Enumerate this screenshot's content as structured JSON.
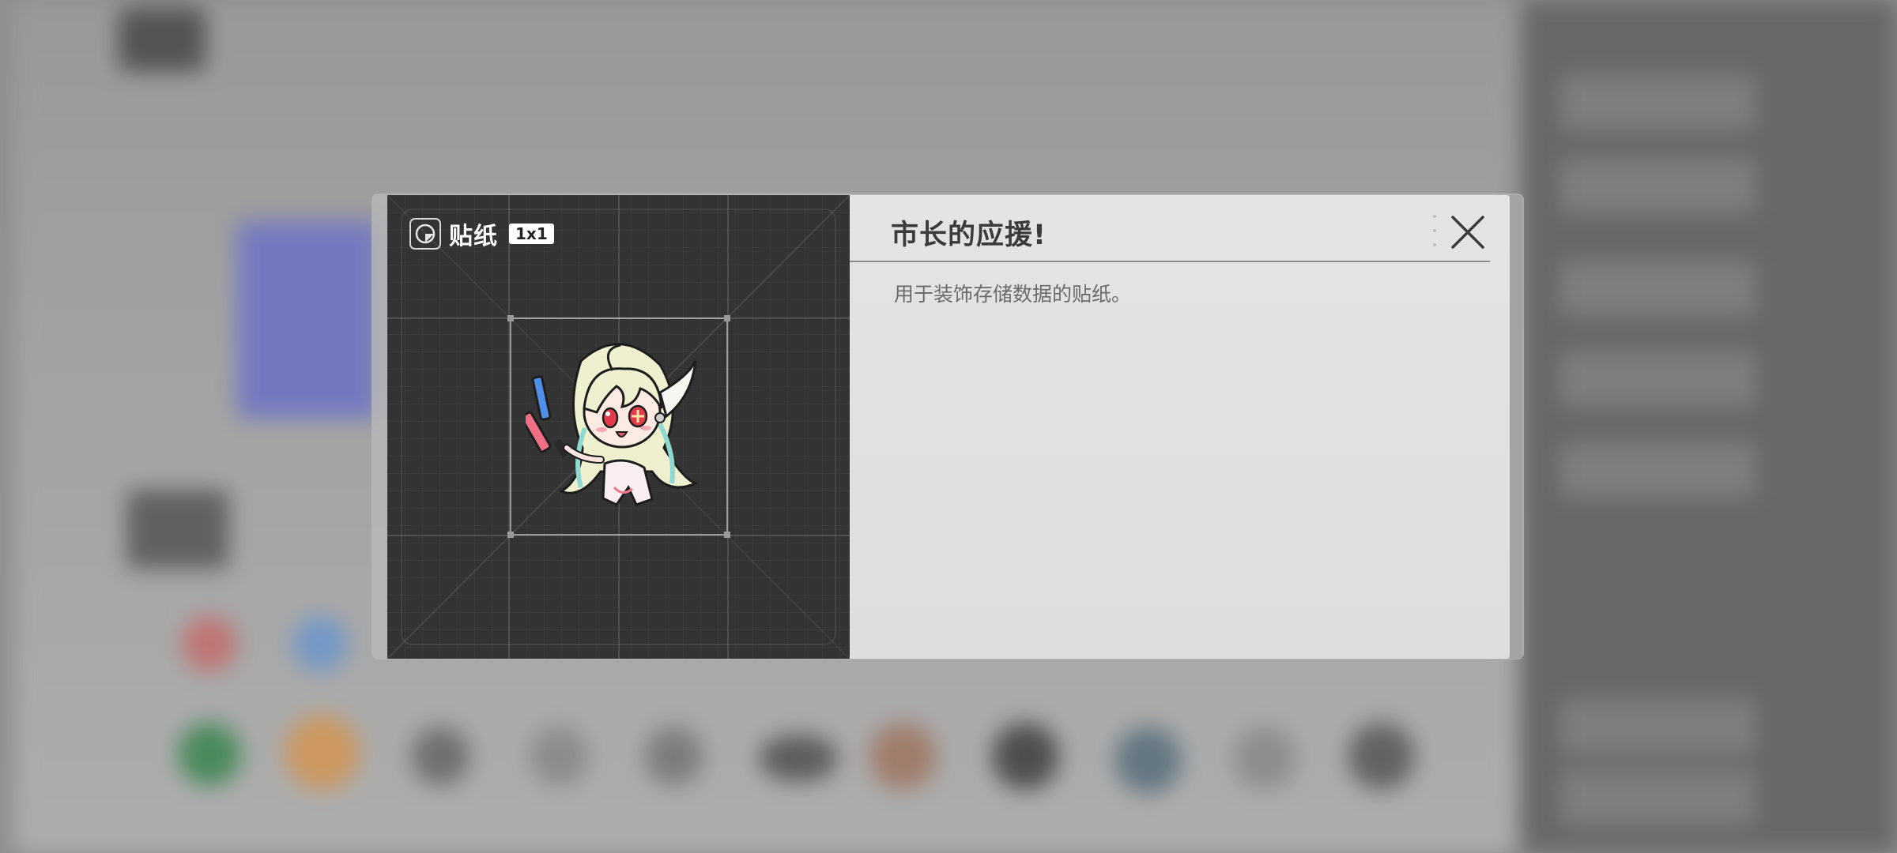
{
  "dialog": {
    "category_label": "贴纸",
    "size_badge": "1x1",
    "title": "市长的应援!",
    "description": "用于装饰存储数据的贴纸。"
  },
  "icons": {
    "category": "sticker-icon",
    "close": "close-icon",
    "more": "more-dots-icon"
  },
  "colors": {
    "preview_bg": "#333333",
    "panel_bg": "#e2e2e2",
    "title_text": "#3b3b3b",
    "description_text": "#6a6a6a"
  }
}
